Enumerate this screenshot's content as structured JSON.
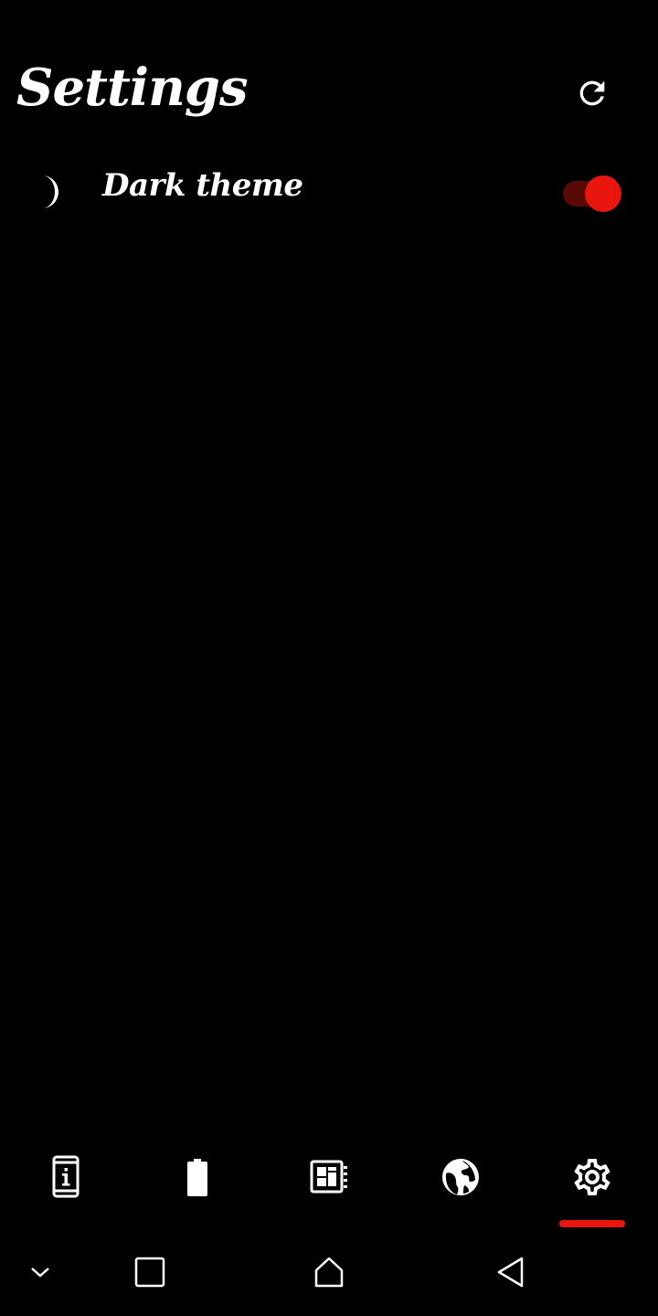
{
  "header": {
    "title": "Settings",
    "refresh_icon": "refresh-icon"
  },
  "settings": {
    "items": [
      {
        "icon": "moon-icon",
        "label": "Dark theme",
        "enabled": true
      }
    ]
  },
  "bottom_nav": {
    "items": [
      {
        "icon": "device-info-icon",
        "selected": false
      },
      {
        "icon": "battery-icon",
        "selected": false
      },
      {
        "icon": "processor-icon",
        "selected": false
      },
      {
        "icon": "globe-icon",
        "selected": false
      },
      {
        "icon": "gear-icon",
        "selected": true
      }
    ]
  },
  "system_bar": {
    "items": [
      "chevron-down-icon",
      "recents-icon",
      "home-icon",
      "back-icon"
    ]
  },
  "colors": {
    "background": "#000000",
    "text": "#ffffff",
    "accent": "#e8160c",
    "toggle_track": "#5a0a06"
  }
}
